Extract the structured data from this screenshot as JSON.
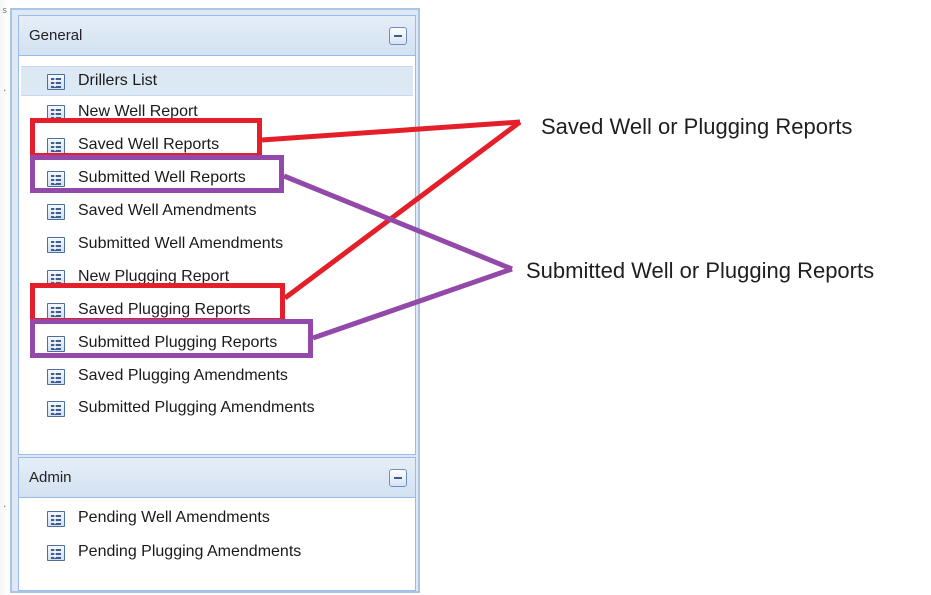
{
  "panels": {
    "general": {
      "title": "General",
      "items": [
        {
          "label": "Drillers List",
          "icon": "form-list-icon",
          "selected": true
        },
        {
          "label": "New Well Report",
          "icon": "form-list-icon"
        },
        {
          "label": "Saved Well Reports",
          "icon": "form-list-icon"
        },
        {
          "label": "Submitted Well Reports",
          "icon": "form-list-icon"
        },
        {
          "label": "Saved Well Amendments",
          "icon": "form-list-icon"
        },
        {
          "label": "Submitted Well Amendments",
          "icon": "form-list-icon"
        },
        {
          "label": "New Plugging Report",
          "icon": "form-list-icon"
        },
        {
          "label": "Saved Plugging Reports",
          "icon": "form-list-icon"
        },
        {
          "label": "Submitted Plugging Reports",
          "icon": "form-list-icon"
        },
        {
          "label": "Saved Plugging Amendments",
          "icon": "form-list-icon"
        },
        {
          "label": "Submitted Plugging Amendments",
          "icon": "form-list-icon"
        }
      ]
    },
    "admin": {
      "title": "Admin",
      "items": [
        {
          "label": "Pending Well Amendments",
          "icon": "form-list-icon"
        },
        {
          "label": "Pending Plugging Amendments",
          "icon": "form-list-icon"
        }
      ]
    }
  },
  "annotations": {
    "saved_callout": "Saved Well or Plugging Reports",
    "submitted_callout": "Submitted Well or Plugging Reports",
    "saved_color": "#e41f2a",
    "submitted_color": "#9249a9"
  }
}
